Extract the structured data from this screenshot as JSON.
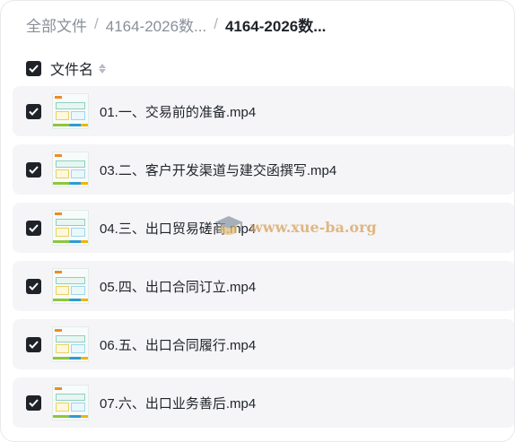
{
  "breadcrumb": {
    "items": [
      "全部文件",
      "4164-2026数...",
      "4164-2026数..."
    ],
    "separator": "/"
  },
  "list_header": {
    "label": "文件名"
  },
  "files": [
    {
      "name": "01.一、交易前的准备.mp4"
    },
    {
      "name": "03.二、客户开发渠道与建交函撰写.mp4"
    },
    {
      "name": "04.三、出口贸易磋商.mp4"
    },
    {
      "name": "05.四、出口合同订立.mp4"
    },
    {
      "name": "06.五、出口合同履行.mp4"
    },
    {
      "name": "07.六、出口业务善后.mp4"
    }
  ],
  "watermark": {
    "text": "www.xue-ba.org"
  },
  "colors": {
    "checkbox": "#1f2329",
    "row_bg": "#f5f5f7",
    "muted_text": "#8a8f99"
  }
}
